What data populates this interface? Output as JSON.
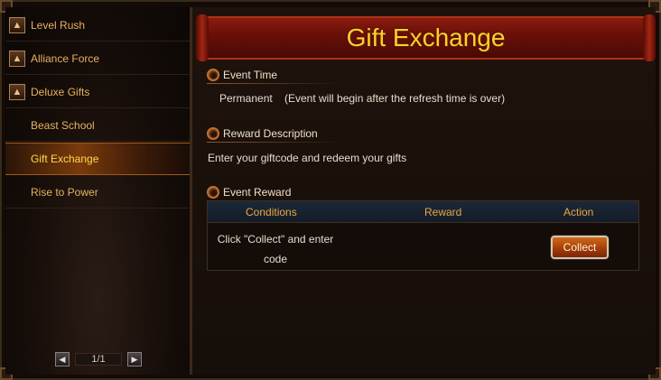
{
  "sidebar": {
    "items": [
      {
        "label": "Level Rush",
        "icon": "thumbs-up-icon",
        "active": false
      },
      {
        "label": "Alliance Force",
        "icon": "thumbs-up-icon",
        "active": false
      },
      {
        "label": "Deluxe Gifts",
        "icon": "thumbs-up-icon",
        "active": false
      },
      {
        "label": "Beast School",
        "icon": "",
        "active": false
      },
      {
        "label": "Gift Exchange",
        "icon": "",
        "active": true
      },
      {
        "label": "Rise to Power",
        "icon": "",
        "active": false
      }
    ],
    "pager": {
      "label": "1/1"
    }
  },
  "main": {
    "title": "Gift Exchange",
    "event_time": {
      "heading": "Event Time",
      "status": "Permanent",
      "note": "(Event will begin after the refresh time is over)"
    },
    "reward_description": {
      "heading": "Reward Description",
      "text": "Enter your giftcode and redeem your gifts"
    },
    "event_reward": {
      "heading": "Event Reward",
      "columns": [
        "Conditions",
        "Reward",
        "Action"
      ],
      "row": {
        "condition_line1": "Click \"Collect\" and enter",
        "condition_line2": "code",
        "reward": "",
        "action_label": "Collect"
      }
    }
  },
  "colors": {
    "accent": "#ffcf2a",
    "sidebar_text": "#e8b060",
    "active_text": "#ffd84a",
    "button": "#a23a08"
  }
}
